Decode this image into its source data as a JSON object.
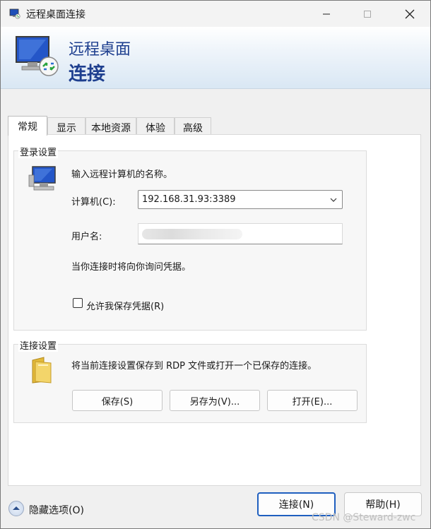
{
  "window": {
    "title": "远程桌面连接",
    "minimize_icon": "minimize-icon",
    "maximize_icon": "maximize-icon",
    "close_icon": "close-icon"
  },
  "banner": {
    "line1": "远程桌面",
    "line2": "连接",
    "icon": "remote-desktop-icon"
  },
  "tabs": [
    {
      "label": "常规",
      "active": true
    },
    {
      "label": "显示",
      "active": false
    },
    {
      "label": "本地资源",
      "active": false
    },
    {
      "label": "体验",
      "active": false
    },
    {
      "label": "高级",
      "active": false
    }
  ],
  "login_group": {
    "title": "登录设置",
    "instruction": "输入远程计算机的名称。",
    "computer_label": "计算机(C):",
    "computer_value": "192.168.31.93:3389",
    "username_label": "用户名:",
    "username_value": "",
    "prompt_text": "当你连接时将向你询问凭据。",
    "save_credentials_label": "允许我保存凭据(R)",
    "save_credentials_checked": false
  },
  "connection_group": {
    "title": "连接设置",
    "description": "将当前连接设置保存到 RDP 文件或打开一个已保存的连接。",
    "save_button": "保存(S)",
    "save_as_button": "另存为(V)...",
    "open_button": "打开(E)..."
  },
  "footer": {
    "hide_options": "隐藏选项(O)",
    "connect_button": "连接(N)",
    "help_button": "帮助(H)"
  },
  "watermark": "CSDN @Steward-zwc"
}
